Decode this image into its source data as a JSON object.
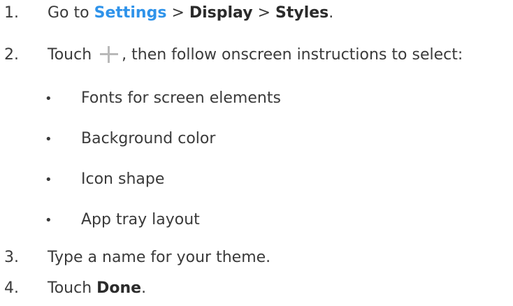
{
  "steps": [
    {
      "number": "1.",
      "prefix": "Go to ",
      "link": "Settings",
      "sep1": " > ",
      "bold1": "Display",
      "sep2": " > ",
      "bold2": "Styles",
      "suffix": "."
    },
    {
      "number": "2.",
      "prefix": "Touch ",
      "icon": "plus-icon",
      "suffix": ", then follow onscreen instructions to select:",
      "bullets": [
        "Fonts for screen elements",
        "Background color",
        "Icon shape",
        "App tray layout"
      ]
    },
    {
      "number": "3.",
      "text": "Type a name for your theme."
    },
    {
      "number": "4.",
      "prefix": "Touch ",
      "bold": "Done",
      "suffix": "."
    }
  ],
  "colors": {
    "link": "#2f93ea",
    "text": "#3a3a3a",
    "icon": "#b9b9b9"
  }
}
